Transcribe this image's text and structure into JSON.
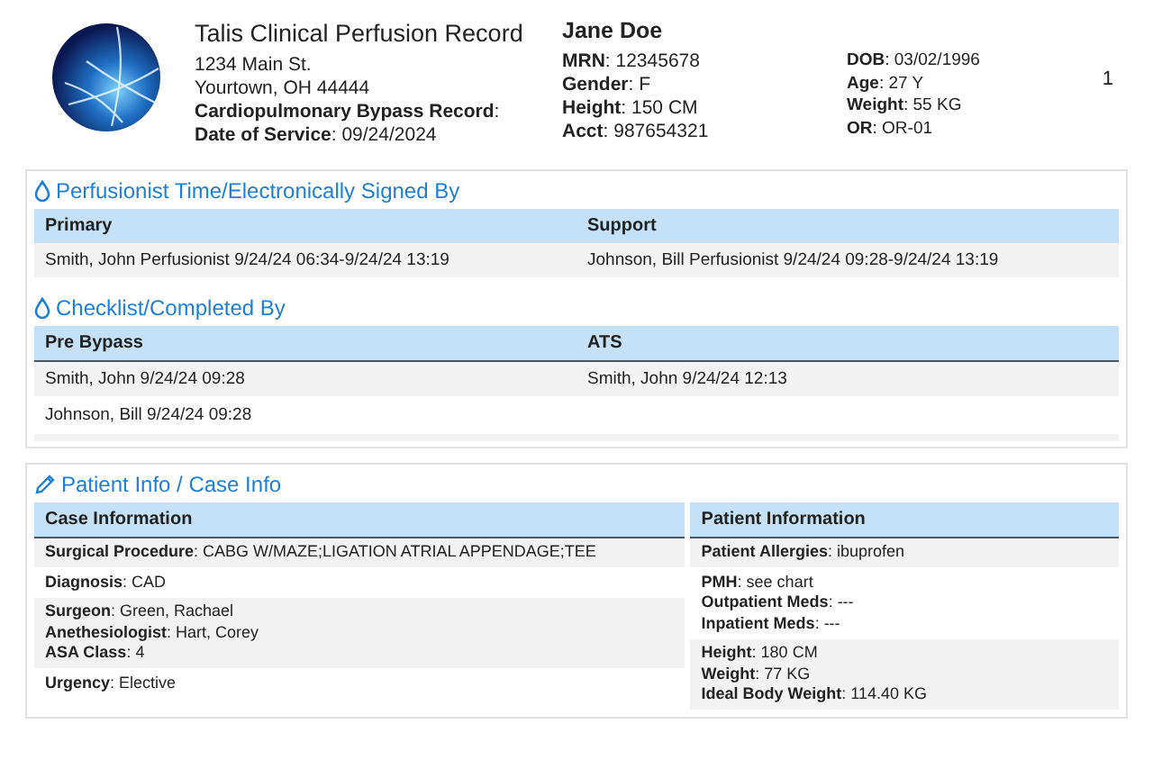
{
  "header": {
    "title": "Talis Clinical Perfusion Record",
    "address_lines": [
      "1234 Main St.",
      "Yourtown, OH 44444"
    ],
    "record_lines": [
      "**Cardiopulmonary Bypass Record**:",
      "**Date of Service**: 09/24/2024"
    ],
    "patient_name": "Jane Doe",
    "patient_fields": [
      "**MRN**: 12345678",
      "**Gender**: F",
      "**Height**: 150 CM",
      "**Acct**: 987654321"
    ],
    "details": [
      "**DOB**: 03/02/1996",
      "**Age**: 27 Y",
      "**Weight**: 55 KG",
      "**OR**: OR-01"
    ],
    "page_number": "1"
  },
  "signature_panel": {
    "groups": [
      {
        "heading": "Perfusionist Time/Electronically Signed By",
        "columns": [
          "Primary",
          "Support"
        ],
        "rows": [
          [
            "Smith, John Perfusionist 9/24/24 06:34-9/24/24 13:19",
            "Johnson, Bill Perfusionist 9/24/24 09:28-9/24/24 13:19"
          ]
        ]
      },
      {
        "heading": "Checklist/Completed By",
        "columns": [
          "Pre Bypass",
          "ATS"
        ],
        "rows": [
          [
            "Smith, John 9/24/24 09:28",
            "Smith, John 9/24/24 12:13"
          ],
          [
            "Johnson, Bill 9/24/24 09:28",
            ""
          ]
        ]
      }
    ]
  },
  "info_panel": {
    "heading": "Patient Info / Case Info",
    "columns": [
      {
        "title": "Case Information",
        "cells": [
          {
            "lines": [
              "**Surgical Procedure**: CABG W/MAZE;LIGATION ATRIAL APPENDAGE;TEE"
            ]
          },
          {
            "lines": [
              "**Diagnosis**: CAD"
            ]
          },
          {
            "lines": [
              "**Surgeon**: Green, Rachael",
              "**Anethesiologist**: Hart, Corey",
              "**ASA Class**: 4"
            ]
          },
          {
            "lines": [
              "**Urgency**: Elective"
            ]
          }
        ]
      },
      {
        "title": "Patient Information",
        "cells": [
          {
            "lines": [
              "**Patient Allergies**: ibuprofen"
            ]
          },
          {
            "lines": [
              "**PMH**: see chart",
              "**Outpatient Meds**: ---",
              "**Inpatient Meds**: ---"
            ]
          },
          {
            "lines": [
              "**Height**: 180 CM",
              "**Weight**: 77 KG",
              "**Ideal Body Weight**: 114.40 KG"
            ]
          }
        ]
      }
    ]
  }
}
